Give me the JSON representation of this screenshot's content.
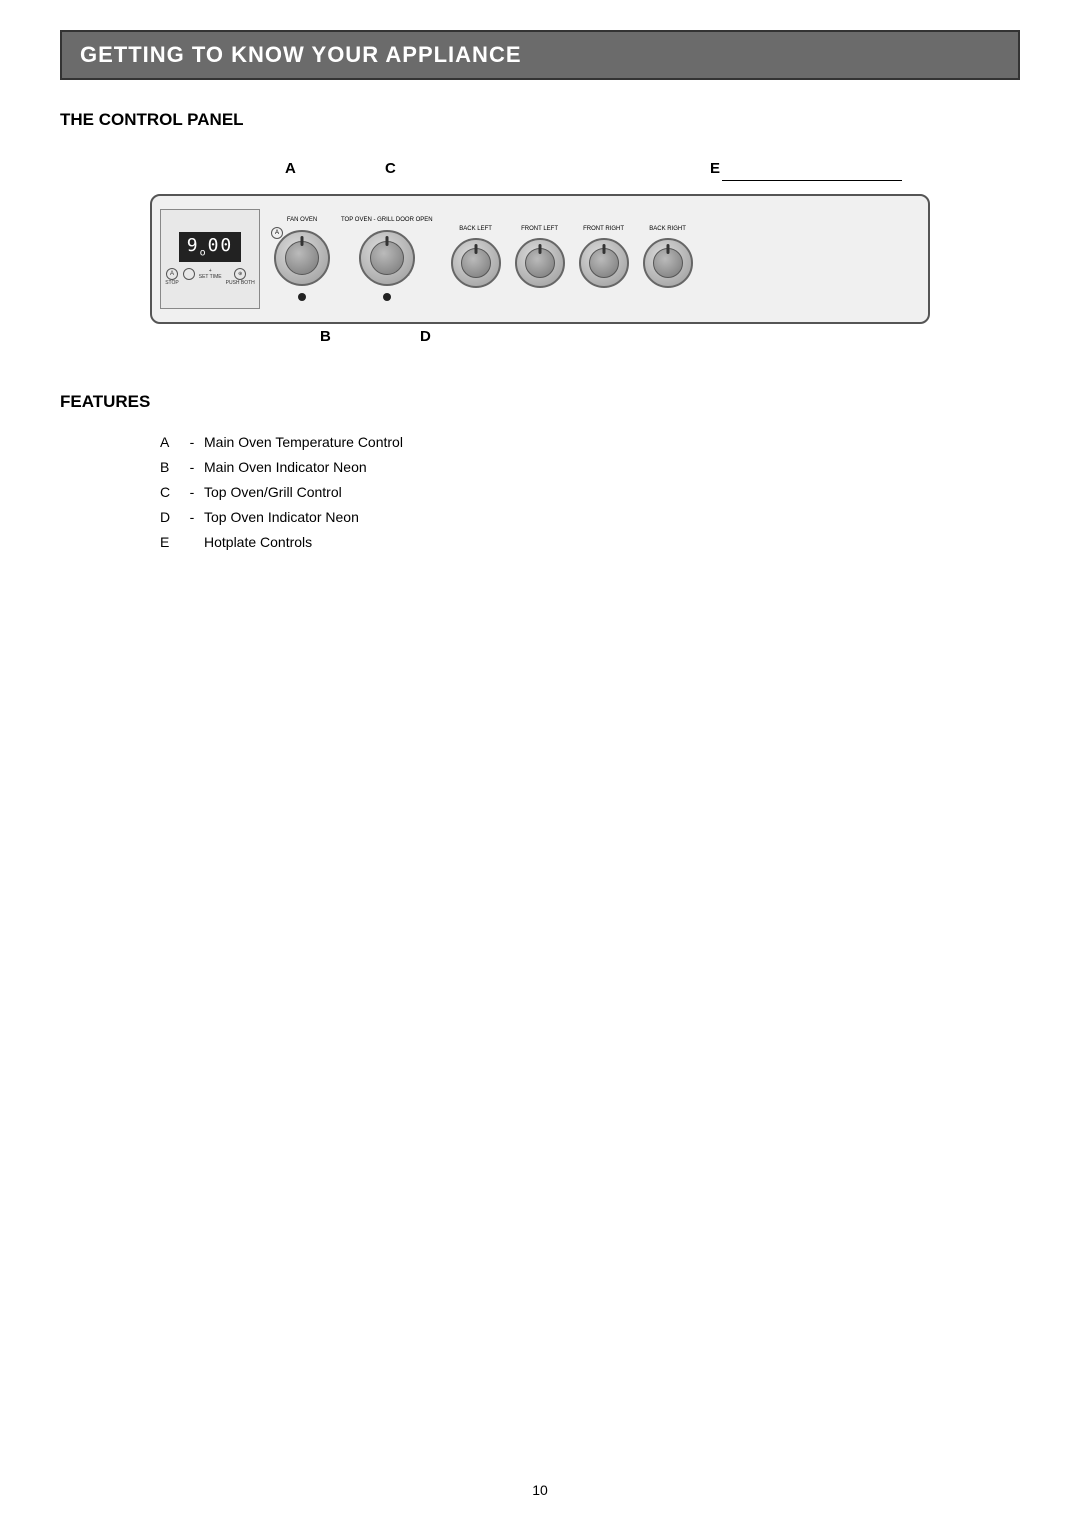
{
  "header": {
    "title": "GETTING TO KNOW YOUR APPLIANCE",
    "bg_color": "#6b6b6b"
  },
  "section1": {
    "title": "THE CONTROL PANEL"
  },
  "panel": {
    "label_A": "A",
    "label_B": "B",
    "label_C": "C",
    "label_D": "D",
    "label_E": "E",
    "timer_display": "9.00",
    "fan_oven_label": "FAN OVEN",
    "top_oven_grill_label": "TOP OVEN - GRILL DOOR OPEN",
    "back_left_label": "BACK LEFT",
    "front_left_label": "FRONT LEFT",
    "front_right_label": "FRONT RIGHT",
    "back_right_label": "BACK RIGHT",
    "stop_label": "STOP",
    "set_time_label": "SET TIME",
    "push_both_label": "PUSH BOTH"
  },
  "section2": {
    "title": "FEATURES"
  },
  "features": [
    {
      "letter": "A",
      "dash": "-",
      "text": "Main Oven Temperature Control"
    },
    {
      "letter": "B",
      "dash": "-",
      "text": "Main Oven Indicator Neon"
    },
    {
      "letter": "C",
      "dash": "-",
      "text": "Top Oven/Grill Control"
    },
    {
      "letter": "D",
      "dash": "-",
      "text": "Top Oven Indicator Neon"
    },
    {
      "letter": "E",
      "dash": "",
      "text": "Hotplate Controls"
    }
  ],
  "page": {
    "number": "10"
  }
}
